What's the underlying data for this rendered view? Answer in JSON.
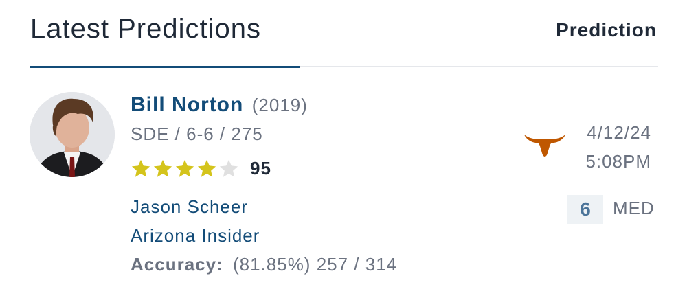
{
  "header": {
    "title": "Latest Predictions",
    "column_label": "Prediction"
  },
  "prediction": {
    "player": {
      "name": "Bill Norton",
      "year": "(2019)",
      "position_size": "SDE / 6-6 / 275",
      "stars": 4,
      "stars_max": 5,
      "rating": "95",
      "avatar_icon": "player-avatar"
    },
    "analyst": {
      "name": "Jason Scheer",
      "role": "Arizona Insider",
      "accuracy_label": "Accuracy:",
      "accuracy_value": "(81.85%) 257 / 314"
    },
    "pick": {
      "team_icon": "longhorn-logo-icon",
      "team_color": "#bf5700",
      "date": "4/12/24",
      "time": "5:08PM",
      "confidence": "6",
      "confidence_label": "MED"
    }
  },
  "colors": {
    "primary": "#134c78",
    "text_muted": "#6b7280",
    "star_filled": "#d4c41c",
    "star_empty": "#e0e0e0"
  }
}
